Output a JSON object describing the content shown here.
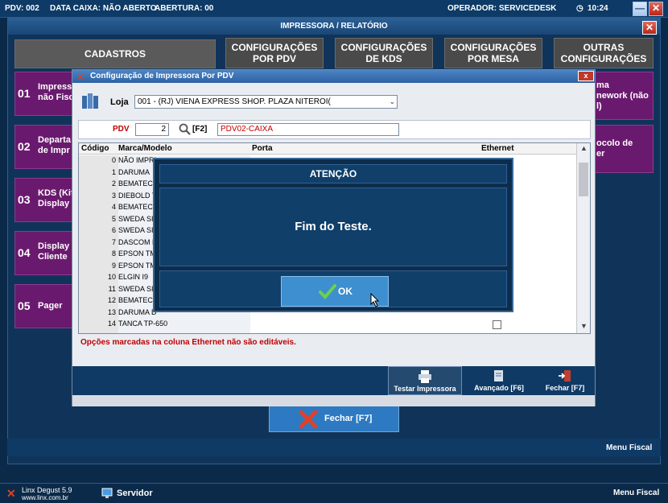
{
  "topbar": {
    "pdv": "PDV: 002",
    "data_caixa": "DATA CAIXA: NÃO ABERTO",
    "abertura": "ABERTURA: 00",
    "operador": "OPERADOR: SERVICEDESK",
    "time": "10:24",
    "minimize": "—",
    "close": "✕"
  },
  "window": {
    "title": "IMPRESSORA / RELATÓRIO",
    "close": "✕"
  },
  "tabs": [
    {
      "label": "CADASTROS"
    },
    {
      "label": "CONFIGURAÇÕES\nPOR PDV"
    },
    {
      "label": "CONFIGURAÇÕES\nDE KDS"
    },
    {
      "label": "CONFIGURAÇÕES\nPOR MESA"
    },
    {
      "label": "OUTRAS\nCONFIGURAÇÕES"
    }
  ],
  "left_cards": [
    {
      "num": "01",
      "label": "Impress\nnão Fisc"
    },
    {
      "num": "02",
      "label": "Departa\nde Impr"
    },
    {
      "num": "03",
      "label": "KDS (Kit\nDisplay"
    },
    {
      "num": "04",
      "label": "Display\nCliente"
    },
    {
      "num": "05",
      "label": "Pager"
    }
  ],
  "right_cards": [
    {
      "label": "ma\nnework (não\nl)"
    },
    {
      "label": "ocolo de\ner"
    }
  ],
  "dialog": {
    "title": "Configuração de Impressora Por PDV",
    "close": "x",
    "loja_label": "Loja",
    "loja_value": "001 - (RJ) VIENA EXPRESS  SHOP. PLAZA NITEROI(",
    "pdv_label": "PDV",
    "pdv_value": "2",
    "f2_label": "[F2]",
    "pdv_name": "PDV02-CAIXA",
    "columns": {
      "codigo": "Código",
      "marca": "Marca/Modelo",
      "porta": "Porta",
      "ethernet": "Ethernet"
    },
    "rows": [
      {
        "cod": "0",
        "marca": "NÃO IMPRI"
      },
      {
        "cod": "1",
        "marca": "DARUMA"
      },
      {
        "cod": "2",
        "marca": "BEMATECH"
      },
      {
        "cod": "3",
        "marca": "DIEBOLD TS"
      },
      {
        "cod": "4",
        "marca": "BEMATECH"
      },
      {
        "cod": "5",
        "marca": "SWEDA SI-"
      },
      {
        "cod": "6",
        "marca": "SWEDA SI-"
      },
      {
        "cod": "7",
        "marca": "DASCOM D"
      },
      {
        "cod": "8",
        "marca": "EPSON TM-"
      },
      {
        "cod": "9",
        "marca": "EPSON TM-"
      },
      {
        "cod": "10",
        "marca": "ELGIN I9"
      },
      {
        "cod": "11",
        "marca": "SWEDA SI-"
      },
      {
        "cod": "12",
        "marca": "BEMATECH"
      },
      {
        "cod": "13",
        "marca": "DARUMA D"
      },
      {
        "cod": "14",
        "marca": "TANCA TP-650"
      }
    ],
    "warning": "Opções marcadas na coluna Ethernet não são editáveis.",
    "buttons": {
      "testar": "Testar Impressora",
      "avancado": "Avançado [F6]",
      "fechar": "Fechar [F7]"
    }
  },
  "modal": {
    "title": "ATENÇÃO",
    "message": "Fim do Teste.",
    "ok": "OK"
  },
  "main_close_button": "Fechar [F7]",
  "menu_fiscal_upper": "Menu Fiscal",
  "statusbar": {
    "app": "Linx Degust 5.9",
    "site": "www.linx.com.br",
    "servidor": "Servidor",
    "menu_fiscal": "Menu Fiscal"
  },
  "colors": {
    "background": "#0b2a4a",
    "purple_card": "#6a1a6e",
    "accent_blue": "#3d8fd0",
    "warning_red": "#c00000"
  }
}
